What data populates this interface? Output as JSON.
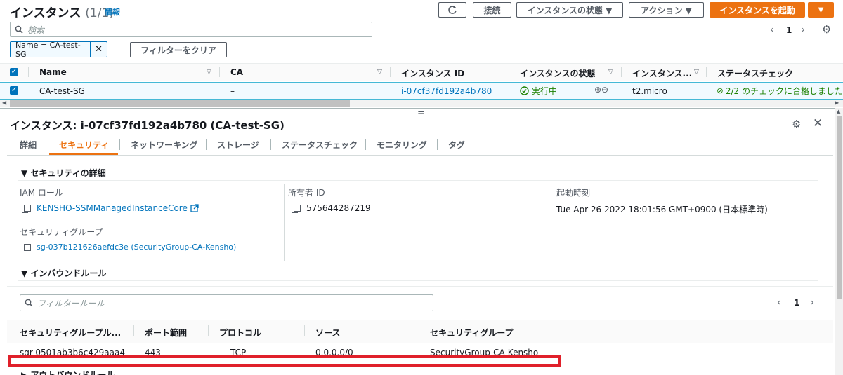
{
  "header": {
    "title": "インスタンス",
    "count": "(1/1)",
    "info_link": "情報",
    "refresh_icon": "refresh-icon",
    "connect_label": "接続",
    "state_menu_label": "インスタンスの状態 ▼",
    "actions_label": "アクション ▼",
    "launch_label": "インスタンスを起動",
    "launch_dropdown": "▼"
  },
  "search": {
    "placeholder": "検索",
    "filter_token": "Name = CA-test-SG",
    "clear_filters_label": "フィルターをクリア",
    "page": "1"
  },
  "table": {
    "columns": [
      "Name",
      "CA",
      "インスタンス ID",
      "インスタンスの状態",
      "インスタンス...",
      "ステータスチェック"
    ],
    "row": {
      "name": "CA-test-SG",
      "ca": "–",
      "instance_id": "i-07cf37fd192a4b780",
      "state": "実行中",
      "type": "t2.micro",
      "status_check": "2/2 のチェックに合格しました"
    }
  },
  "detail": {
    "drag_handle": "=",
    "title": "インスタンス: i-07cf37fd192a4b780 (CA-test-SG)",
    "tabs": [
      "詳細",
      "セキュリティ",
      "ネットワーキング",
      "ストレージ",
      "ステータスチェック",
      "モニタリング",
      "タグ"
    ],
    "active_tab": "セキュリティ",
    "security_details_heading": "▼ セキュリティの詳細",
    "iam_role_label": "IAM ロール",
    "iam_role_value": "KENSHO-SSMManagedInstanceCore",
    "owner_id_label": "所有者 ID",
    "owner_id_value": "575644287219",
    "launch_time_label": "起動時刻",
    "launch_time_value": "Tue Apr 26 2022 18:01:56 GMT+0900 (日本標準時)",
    "security_groups_label": "セキュリティグループ",
    "security_groups_value": "sg-037b121626aefdc3e (SecurityGroup-CA-Kensho)",
    "inbound_heading": "▼ インバウンドルール",
    "filter_placeholder": "フィルタールール",
    "rules_page": "1",
    "rules_columns": [
      "セキュリティグループル...",
      "ポート範囲",
      "プロトコル",
      "ソース",
      "セキュリティグループ"
    ],
    "rules_row": [
      "sgr-0501ab3b6c429aaa4",
      "443",
      "TCP",
      "0.0.0.0/0",
      "SecurityGroup-CA-Kensho"
    ],
    "outbound_heading": "▶ アウトバウンドルール"
  },
  "colors": {
    "accent": "#ec7211",
    "link": "#0073bb",
    "success": "#1d8102",
    "highlight_box": "#e0202a"
  }
}
